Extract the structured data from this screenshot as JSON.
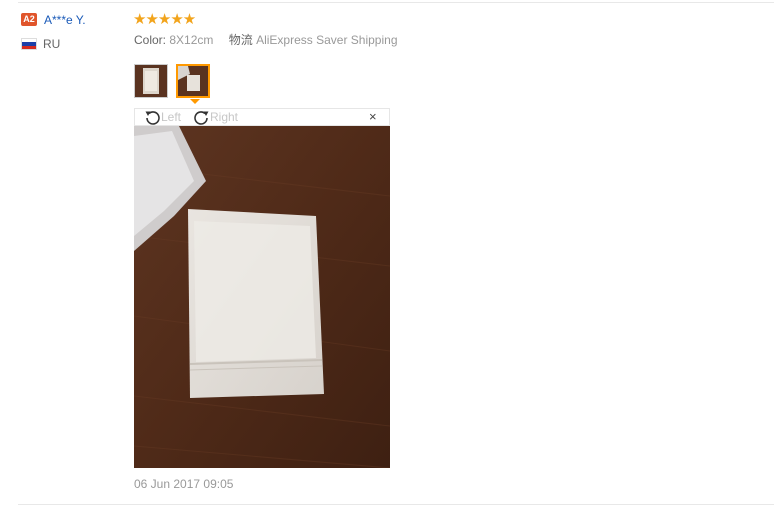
{
  "reviewer": {
    "level_badge": "A2",
    "name": "A***e Y.",
    "country_code": "RU"
  },
  "review": {
    "rating": 5,
    "stars_text": "★★★★★",
    "color_label": "Color:",
    "color_value": "8X12cm",
    "shipping_label": "物流",
    "shipping_value": "AliExpress Saver Shipping",
    "date": "06 Jun 2017 09:05"
  },
  "viewer": {
    "rotate_left_label": "Left",
    "rotate_right_label": "Right",
    "close_symbol": "×",
    "selected_thumb": 2
  },
  "colors": {
    "star": "#f2a41c",
    "name_link": "#1a5ab8",
    "badge": "#e0552b",
    "thumb_active_border": "#f90"
  }
}
